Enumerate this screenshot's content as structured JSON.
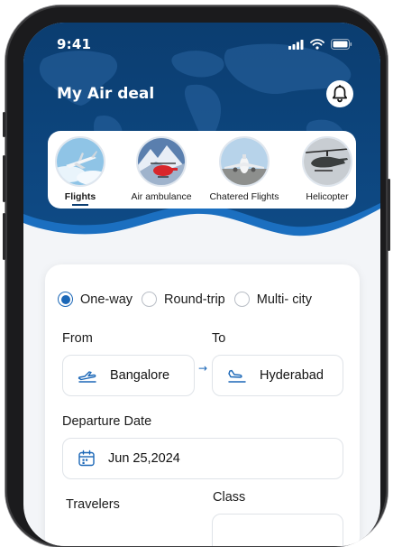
{
  "status_bar": {
    "time": "9:41"
  },
  "app": {
    "title": "My Air deal"
  },
  "categories": [
    {
      "label": "Flights",
      "active": true
    },
    {
      "label": "Air ambulance",
      "active": false
    },
    {
      "label": "Chatered Flights",
      "active": false
    },
    {
      "label": "Helicopter",
      "active": false
    }
  ],
  "trip_types": [
    {
      "label": "One-way",
      "checked": true
    },
    {
      "label": "Round-trip",
      "checked": false
    },
    {
      "label": "Multi- city",
      "checked": false
    }
  ],
  "form": {
    "from_label": "From",
    "from_value": "Bangalore",
    "to_label": "To",
    "to_value": "Hyderabad",
    "departure_label": "Departure Date",
    "departure_value": "Jun 25,2024",
    "travelers_label": "Travelers",
    "class_label": "Class"
  },
  "colors": {
    "header_dark": "#0a3a6b",
    "header_mid": "#1b5fa0",
    "accent": "#1b67b7",
    "frame": "#1b1b1d"
  },
  "icons": {
    "bell": "bell-icon",
    "takeoff": "takeoff-icon",
    "landing": "landing-icon",
    "calendar": "calendar-icon",
    "arrow": "arrow-right-icon"
  }
}
